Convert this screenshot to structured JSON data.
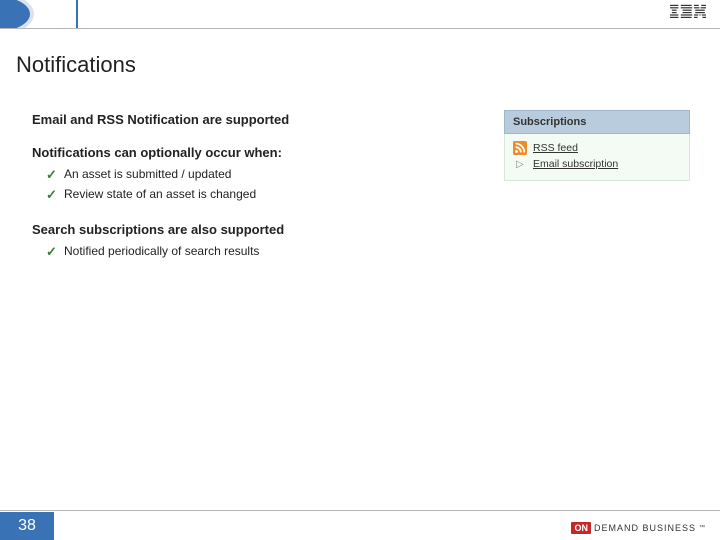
{
  "slide": {
    "title": "Notifications",
    "heading1": "Email and RSS Notification are supported",
    "heading2": "Notifications can optionally occur when:",
    "bullets2": [
      "An asset is submitted / updated",
      "Review state of an asset is changed"
    ],
    "heading3": "Search subscriptions are also supported",
    "bullets3": [
      "Notified periodically of search results"
    ]
  },
  "subscriptions": {
    "header": "Subscriptions",
    "rss_label": "RSS feed",
    "email_label": "Email subscription"
  },
  "footer": {
    "page": "38",
    "on": "ON",
    "demand": "DEMAND BUSINESS"
  }
}
